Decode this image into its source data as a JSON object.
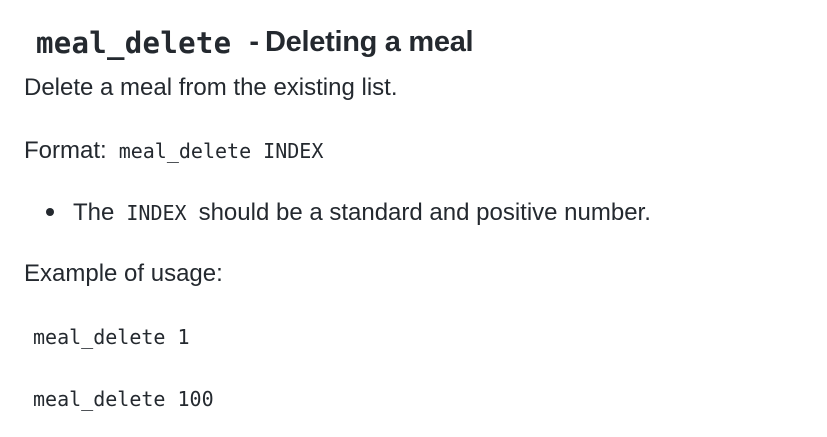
{
  "heading": {
    "command": "meal_delete",
    "separator": "-",
    "title": "Deleting a meal"
  },
  "description": "Delete a meal from the existing list.",
  "format": {
    "label": "Format:",
    "code": "meal_delete INDEX"
  },
  "bullets": [
    {
      "prefix": "The",
      "code": "INDEX",
      "suffix": "should be a standard and positive number."
    }
  ],
  "example": {
    "label": "Example of usage:",
    "lines": [
      "meal_delete 1",
      "meal_delete 100"
    ]
  }
}
